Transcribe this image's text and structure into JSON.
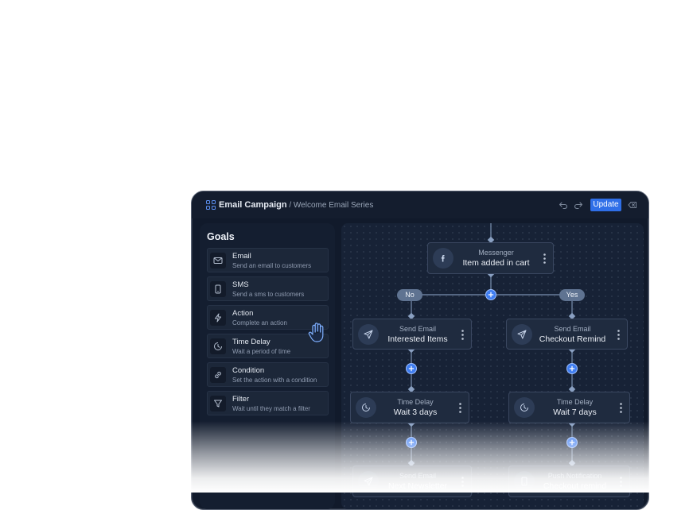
{
  "header": {
    "app_title": "Email Campaign",
    "separator": " / ",
    "breadcrumb": "Welcome Email Series",
    "update_label": "Update"
  },
  "sidebar": {
    "title": "Goals",
    "items": [
      {
        "name": "Email",
        "desc": "Send an email to customers",
        "icon": "mail-icon"
      },
      {
        "name": "SMS",
        "desc": "Send a sms to customers",
        "icon": "phone-icon"
      },
      {
        "name": "Action",
        "desc": "Complete an action",
        "icon": "lightning-icon"
      },
      {
        "name": "Time Delay",
        "desc": "Wait a period of time",
        "icon": "clock-icon"
      },
      {
        "name": "Condition",
        "desc": "Set the action with a condition",
        "icon": "link-icon"
      },
      {
        "name": "Filter",
        "desc": "Wait until they match a filter",
        "icon": "filter-icon"
      }
    ]
  },
  "flow": {
    "trigger": {
      "type": "Messenger",
      "label": "Item added in cart",
      "icon": "facebook-icon"
    },
    "branch_no": "No",
    "branch_yes": "Yes",
    "left": [
      {
        "type": "Send Email",
        "label": "Interested Items",
        "icon": "send-icon"
      },
      {
        "type": "Time Delay",
        "label": "Wait 3 days",
        "icon": "clock-icon"
      },
      {
        "type": "Send Email",
        "label": "Next Newsletter",
        "icon": "send-icon"
      }
    ],
    "right": [
      {
        "type": "Send Email",
        "label": "Checkout Remind",
        "icon": "send-icon"
      },
      {
        "type": "Time Delay",
        "label": "Wait 7 days",
        "icon": "clock-icon"
      },
      {
        "type": "Push Notification",
        "label": "Checkout remind",
        "icon": "phone-icon"
      }
    ]
  },
  "colors": {
    "accent": "#2f6fe8",
    "background": "#111a2b",
    "node": "#1f2b3f",
    "connector": "#7a8fb0"
  }
}
